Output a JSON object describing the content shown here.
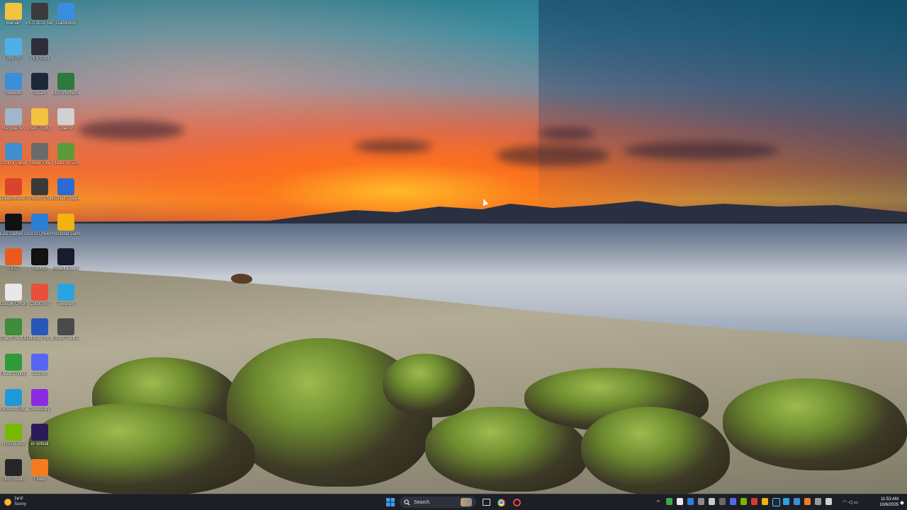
{
  "desktop": {
    "icons": [
      {
        "label": "ManiaP",
        "icon": "folder-icon",
        "color": "#f3c33f"
      },
      {
        "label": "PES 2019 Settings",
        "icon": "pes-settings-icon",
        "color": "#3a3a3a"
      },
      {
        "label": "Gameloop",
        "icon": "gameloop-icon",
        "color": "#3b8de0"
      },
      {
        "label": "This PC",
        "icon": "this-pc-icon",
        "color": "#4fb0e8"
      },
      {
        "label": "PES 2019",
        "icon": "pes-icon",
        "color": "#2e2e3a"
      },
      {
        "label": "Network",
        "icon": "network-icon",
        "color": "#3a90d8"
      },
      {
        "label": "Steam",
        "icon": "steam-icon",
        "color": "#1b2838"
      },
      {
        "label": "MSI Afterburner",
        "icon": "msi-afterburner-icon",
        "color": "#2d7a3c"
      },
      {
        "label": "Recycle Bin",
        "icon": "recycle-bin-icon",
        "color": "#9fb7c8"
      },
      {
        "label": "me6771283",
        "icon": "folder-icon",
        "color": "#f3c33f"
      },
      {
        "label": "OpenIV",
        "icon": "openiv-icon",
        "color": "#d0d0d0"
      },
      {
        "label": "Control Panel",
        "icon": "control-panel-icon",
        "color": "#3e8fd0"
      },
      {
        "label": "Sniper Elite",
        "icon": "sniper-elite-icon",
        "color": "#6a6a6a"
      },
      {
        "label": "Plants vs. Zombies",
        "icon": "plants-vs-zombies-icon",
        "color": "#5c9a3a"
      },
      {
        "label": "Dragonframe 2022",
        "icon": "dragonframe-icon",
        "color": "#d8452c"
      },
      {
        "label": "Armoury Crate",
        "icon": "armoury-crate-icon",
        "color": "#3a3a3a"
      },
      {
        "label": "Rocket League®",
        "icon": "rocket-league-icon",
        "color": "#2c6bd0"
      },
      {
        "label": "Epic Games Launcher",
        "icon": "epic-games-icon",
        "color": "#111111"
      },
      {
        "label": "ASUS DriverHub",
        "icon": "asus-driverhub-icon",
        "color": "#2a7fd4"
      },
      {
        "label": "Rockstar Games...",
        "icon": "rockstar-icon",
        "color": "#f2b20f"
      },
      {
        "label": "GCC",
        "icon": "gcc-icon",
        "color": "#ea5a1c"
      },
      {
        "label": "CapCut",
        "icon": "capcut-icon",
        "color": "#111111"
      },
      {
        "label": "Ubisoft Connect",
        "icon": "ubisoft-icon",
        "color": "#1a1a2e"
      },
      {
        "label": "Google Chrome",
        "icon": "chrome-icon",
        "color": "#e8e8e8"
      },
      {
        "label": "Color Grid",
        "icon": "color-grid-icon",
        "color": "#e7503b"
      },
      {
        "label": "Telegram",
        "icon": "telegram-icon",
        "color": "#2aa3e0"
      },
      {
        "label": "Grand Theft Auto V",
        "icon": "gta-v-icon",
        "color": "#3f8c3a"
      },
      {
        "label": "Ultimate Str...",
        "icon": "ultimate-icon",
        "color": "#2757b8"
      },
      {
        "label": "Grand Theft Auto",
        "icon": "gta-icon",
        "color": "#4a4a4a"
      },
      {
        "label": "FiveM Configurator",
        "icon": "fivem-config-icon",
        "color": "#2e9a3a"
      },
      {
        "label": "Discord",
        "icon": "discord-icon",
        "color": "#5865f2"
      },
      {
        "label": "Microsoft Edge",
        "icon": "edge-icon",
        "color": "#1f9ad6"
      },
      {
        "label": "DriverEasy",
        "icon": "drivereasy-icon",
        "color": "#8a2be2"
      },
      {
        "label": "NVIDIA App",
        "icon": "nvidia-icon",
        "color": "#76b900"
      },
      {
        "label": "eFootball",
        "icon": "efootball-icon",
        "color": "#2a1a5a"
      },
      {
        "label": "OBS Studio",
        "icon": "obs-icon",
        "color": "#262626"
      },
      {
        "label": "FiveM",
        "icon": "fivem-icon",
        "color": "#f47b20"
      }
    ]
  },
  "taskbar": {
    "weather_temp": "74°F",
    "weather_desc": "Sunny",
    "search_placeholder": "Search",
    "time": "11:53 AM",
    "date": "10/6/2025",
    "accent": "#1c1f26"
  }
}
